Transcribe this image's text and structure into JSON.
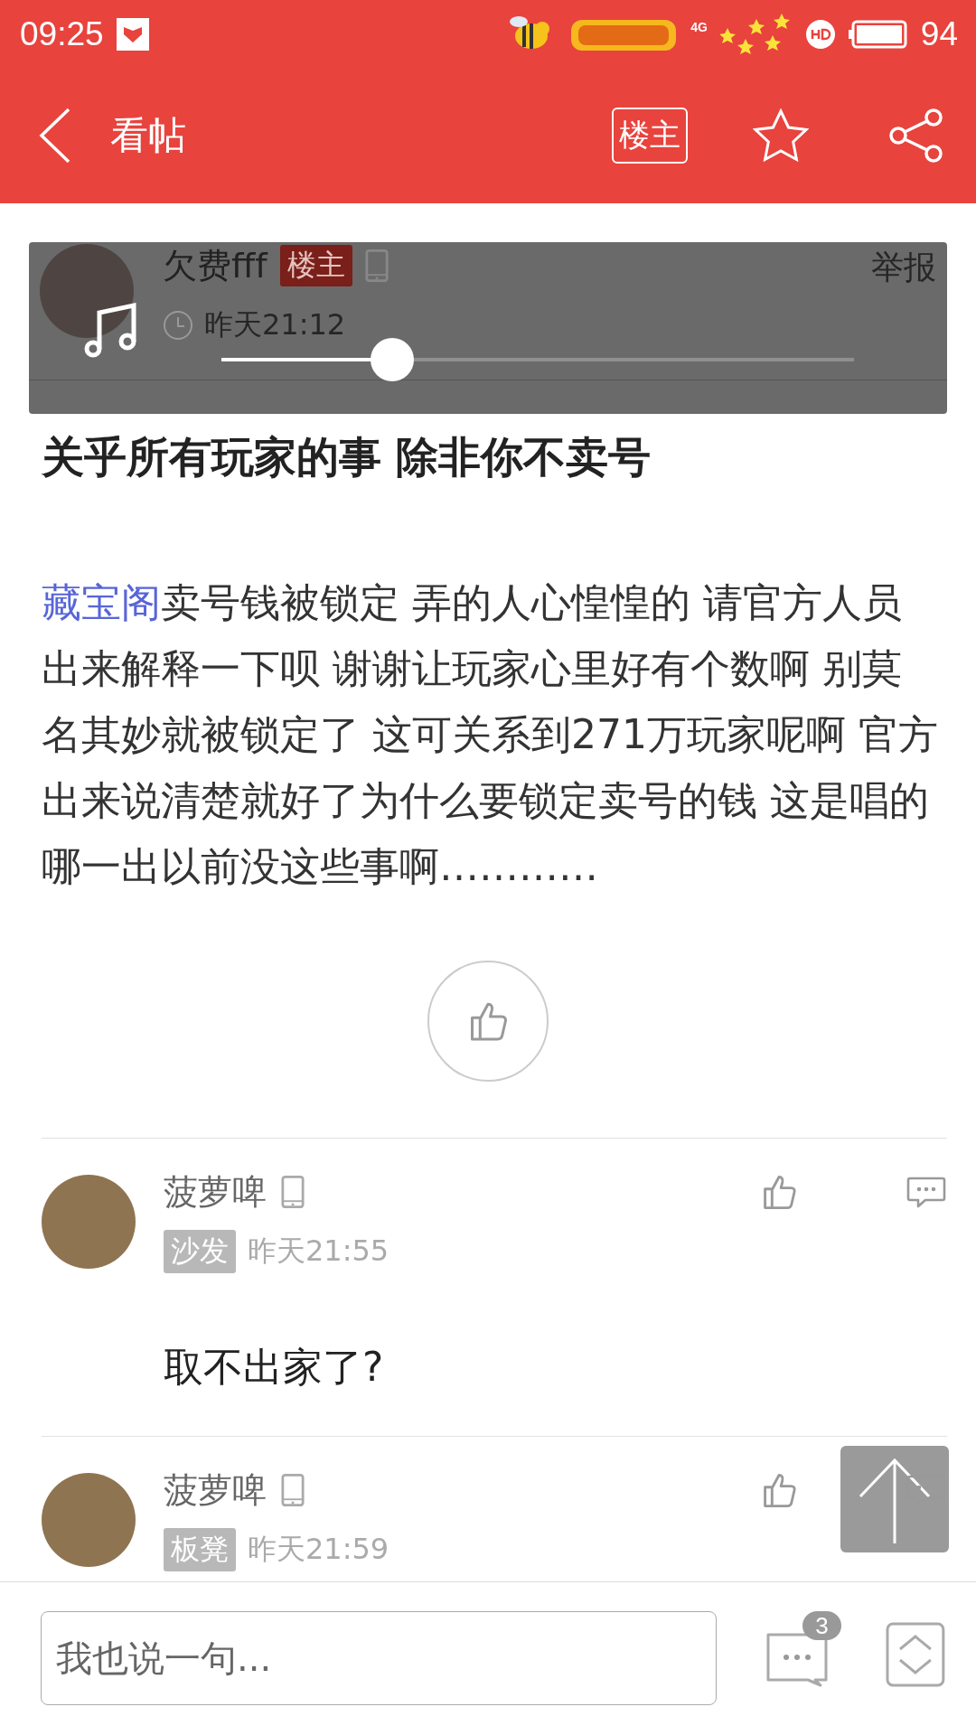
{
  "status_bar": {
    "time": "09:25",
    "network": "4G",
    "battery": "94"
  },
  "header": {
    "title": "看帖",
    "op_button": "楼主"
  },
  "post": {
    "author": {
      "name": "欠费fff",
      "badge": "楼主",
      "time": "昨天21:12",
      "report": "举报"
    },
    "player": {
      "level": 0.27
    },
    "title": "关乎所有玩家的事 除非你不卖号",
    "body": {
      "link": "藏宝阁",
      "text": "卖号钱被锁定 弄的人心惶惶的 请官方人员出来解释一下呗 谢谢让玩家心里好有个数啊 别莫名其妙就被锁定了 这可关系到271万玩家呢啊 官方出来说清楚就好了为什么要锁定卖号的钱 这是唱的哪一出以前没这些事啊…………"
    }
  },
  "replies": [
    {
      "name": "菠萝啤",
      "floor": "沙发",
      "time": "昨天21:55",
      "content": "取不出家了?"
    },
    {
      "name": "菠萝啤",
      "floor": "板凳",
      "time": "昨天21:59"
    }
  ],
  "composer": {
    "placeholder": "我也说一句...",
    "reply_count": "3"
  }
}
